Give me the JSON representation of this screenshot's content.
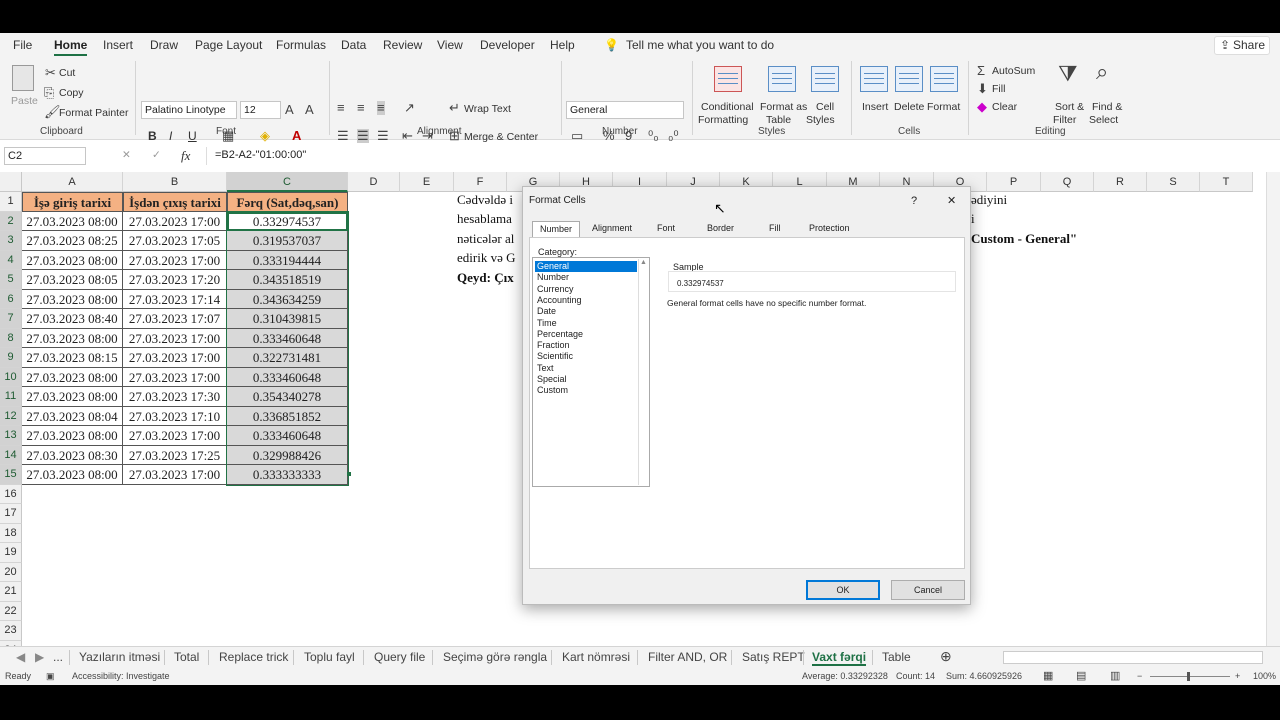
{
  "ribbon_tabs": [
    "File",
    "Home",
    "Insert",
    "Draw",
    "Page Layout",
    "Formulas",
    "Data",
    "Review",
    "View",
    "Developer",
    "Help"
  ],
  "tell_me": "Tell me what you want to do",
  "share_label": "Share",
  "clipboard": {
    "paste": "Paste",
    "cut": "Cut",
    "copy": "Copy",
    "format_painter": "Format Painter",
    "label": "Clipboard"
  },
  "font": {
    "name": "Palatino Linotype",
    "size": "12",
    "label": "Font",
    "bold": "B",
    "italic": "I",
    "underline": "U"
  },
  "alignment": {
    "wrap": "Wrap Text",
    "merge": "Merge & Center",
    "label": "Alignment"
  },
  "number": {
    "format": "General",
    "label": "Number"
  },
  "styles": {
    "conditional": "Conditional",
    "conditional2": "Formatting",
    "format_table": "Format as",
    "format_table2": "Table",
    "cell_styles": "Cell",
    "cell_styles2": "Styles",
    "label": "Styles"
  },
  "cells": {
    "insert": "Insert",
    "delete": "Delete",
    "format": "Format",
    "label": "Cells"
  },
  "editing": {
    "autosum": "AutoSum",
    "fill": "Fill",
    "clear": "Clear",
    "sort": "Sort &",
    "sort2": "Filter",
    "find": "Find &",
    "find2": "Select",
    "label": "Editing"
  },
  "name_box": "C2",
  "formula": "=B2-A2-\"01:00:00\"",
  "columns": [
    "A",
    "B",
    "C",
    "D",
    "E",
    "F",
    "G",
    "H",
    "I",
    "J",
    "K",
    "L",
    "M",
    "N",
    "O",
    "P",
    "Q",
    "R",
    "S",
    "T"
  ],
  "rows": [
    "1",
    "2",
    "3",
    "4",
    "5",
    "6",
    "7",
    "8",
    "9",
    "10",
    "11",
    "12",
    "13",
    "14",
    "15",
    "16",
    "17",
    "18",
    "19",
    "20",
    "21",
    "22",
    "23",
    "24"
  ],
  "header_row": [
    "İşə giriş tarixi",
    "İşdən çıxış tarixi",
    "Fərq (Sat,dəq,san)"
  ],
  "table": [
    [
      "27.03.2023 08:00",
      "27.03.2023 17:00",
      "0.332974537"
    ],
    [
      "27.03.2023 08:25",
      "27.03.2023 17:05",
      "0.319537037"
    ],
    [
      "27.03.2023 08:00",
      "27.03.2023 17:00",
      "0.333194444"
    ],
    [
      "27.03.2023 08:05",
      "27.03.2023 17:20",
      "0.343518519"
    ],
    [
      "27.03.2023 08:00",
      "27.03.2023 17:14",
      "0.343634259"
    ],
    [
      "27.03.2023 08:40",
      "27.03.2023 17:07",
      "0.310439815"
    ],
    [
      "27.03.2023 08:00",
      "27.03.2023 17:00",
      "0.333460648"
    ],
    [
      "27.03.2023 08:15",
      "27.03.2023 17:00",
      "0.322731481"
    ],
    [
      "27.03.2023 08:00",
      "27.03.2023 17:00",
      "0.333460648"
    ],
    [
      "27.03.2023 08:00",
      "27.03.2023 17:30",
      "0.354340278"
    ],
    [
      "27.03.2023 08:04",
      "27.03.2023 17:10",
      "0.336851852"
    ],
    [
      "27.03.2023 08:00",
      "27.03.2023 17:00",
      "0.333460648"
    ],
    [
      "27.03.2023 08:30",
      "27.03.2023 17:25",
      "0.329988426"
    ],
    [
      "27.03.2023 08:00",
      "27.03.2023 17:00",
      "0.333333333"
    ]
  ],
  "notes": {
    "l1": "Cədvəldə i",
    "l2": "hesablama",
    "l3": "nəticələr al",
    "l4": "edirik və G",
    "l5": "Qeyd: Çıx",
    "r1": "ədiyini",
    "r2": "i",
    "r3": "Custom - General\""
  },
  "sheet_tabs": [
    "...",
    "Yazıların itməsi",
    "Total",
    "Replace trick",
    "Toplu fayl",
    "Query file",
    "Seçimə görə rəngla",
    "Kart nömrəsi",
    "Filter AND, OR",
    "Satış REPT",
    "Vaxt fərqi",
    "Table"
  ],
  "status": {
    "ready": "Ready",
    "accessibility": "Accessibility: Investigate",
    "average": "Average: 0.33292328",
    "count": "Count: 14",
    "sum": "Sum: 4.660925926",
    "zoom": "100%"
  },
  "dialog": {
    "title": "Format Cells",
    "help": "?",
    "close": "✕",
    "tabs": [
      "Number",
      "Alignment",
      "Font",
      "Border",
      "Fill",
      "Protection"
    ],
    "category_label": "Category:",
    "categories": [
      "General",
      "Number",
      "Currency",
      "Accounting",
      "Date",
      "Time",
      "Percentage",
      "Fraction",
      "Scientific",
      "Text",
      "Special",
      "Custom"
    ],
    "sample_label": "Sample",
    "sample_value": "0.332974537",
    "description": "General format cells have no specific number format.",
    "ok": "OK",
    "cancel": "Cancel"
  }
}
